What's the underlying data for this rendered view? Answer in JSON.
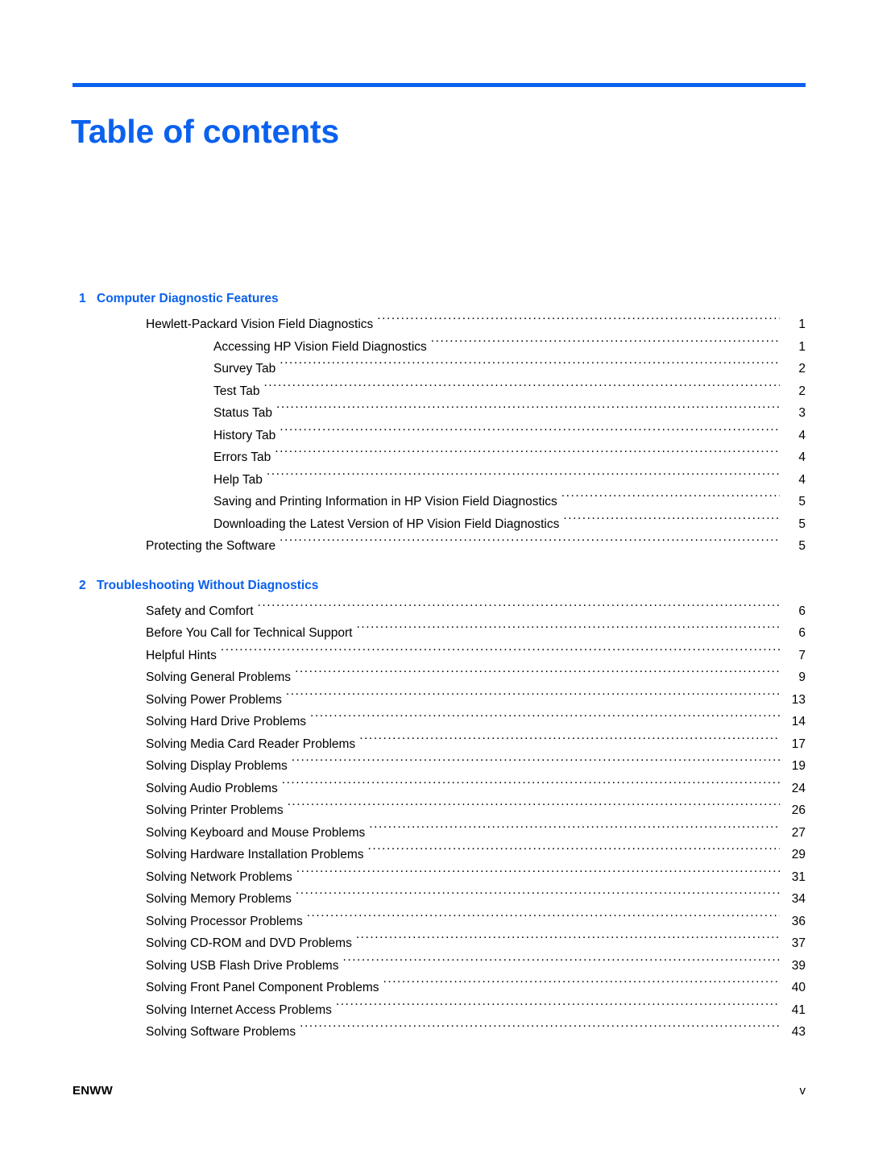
{
  "document": {
    "title": "Table of contents",
    "accent_color": "#0b61ee",
    "text_color": "#000000",
    "background_color": "#ffffff"
  },
  "toc": {
    "chapters": [
      {
        "number": "1",
        "title": "Computer Diagnostic Features",
        "entries": [
          {
            "level": 1,
            "text": "Hewlett-Packard Vision Field Diagnostics",
            "page": "1"
          },
          {
            "level": 2,
            "text": "Accessing HP Vision Field Diagnostics",
            "page": "1"
          },
          {
            "level": 2,
            "text": "Survey Tab",
            "page": "2"
          },
          {
            "level": 2,
            "text": "Test Tab",
            "page": "2"
          },
          {
            "level": 2,
            "text": "Status Tab",
            "page": "3"
          },
          {
            "level": 2,
            "text": "History Tab",
            "page": "4"
          },
          {
            "level": 2,
            "text": "Errors Tab",
            "page": "4"
          },
          {
            "level": 2,
            "text": "Help Tab",
            "page": "4"
          },
          {
            "level": 2,
            "text": "Saving and Printing Information in HP Vision Field Diagnostics",
            "page": "5"
          },
          {
            "level": 2,
            "text": "Downloading the Latest Version of HP Vision Field Diagnostics",
            "page": "5"
          },
          {
            "level": 1,
            "text": "Protecting the Software",
            "page": "5"
          }
        ]
      },
      {
        "number": "2",
        "title": "Troubleshooting Without Diagnostics",
        "entries": [
          {
            "level": 1,
            "text": "Safety and Comfort",
            "page": "6"
          },
          {
            "level": 1,
            "text": "Before You Call for Technical Support",
            "page": "6"
          },
          {
            "level": 1,
            "text": "Helpful Hints",
            "page": "7"
          },
          {
            "level": 1,
            "text": "Solving General Problems",
            "page": "9"
          },
          {
            "level": 1,
            "text": "Solving Power Problems",
            "page": "13"
          },
          {
            "level": 1,
            "text": "Solving Hard Drive Problems",
            "page": "14"
          },
          {
            "level": 1,
            "text": "Solving Media Card Reader Problems",
            "page": "17"
          },
          {
            "level": 1,
            "text": "Solving Display Problems",
            "page": "19"
          },
          {
            "level": 1,
            "text": "Solving Audio Problems",
            "page": "24"
          },
          {
            "level": 1,
            "text": "Solving Printer Problems",
            "page": "26"
          },
          {
            "level": 1,
            "text": "Solving Keyboard and Mouse Problems",
            "page": "27"
          },
          {
            "level": 1,
            "text": "Solving Hardware Installation Problems",
            "page": "29"
          },
          {
            "level": 1,
            "text": "Solving Network Problems",
            "page": "31"
          },
          {
            "level": 1,
            "text": "Solving Memory Problems",
            "page": "34"
          },
          {
            "level": 1,
            "text": "Solving Processor Problems",
            "page": "36"
          },
          {
            "level": 1,
            "text": "Solving CD-ROM and DVD Problems",
            "page": "37"
          },
          {
            "level": 1,
            "text": "Solving USB Flash Drive Problems",
            "page": "39"
          },
          {
            "level": 1,
            "text": "Solving Front Panel Component Problems",
            "page": "40"
          },
          {
            "level": 1,
            "text": "Solving Internet Access Problems",
            "page": "41"
          },
          {
            "level": 1,
            "text": "Solving Software Problems",
            "page": "43"
          }
        ]
      }
    ]
  },
  "footer": {
    "left": "ENWW",
    "right": "v"
  }
}
